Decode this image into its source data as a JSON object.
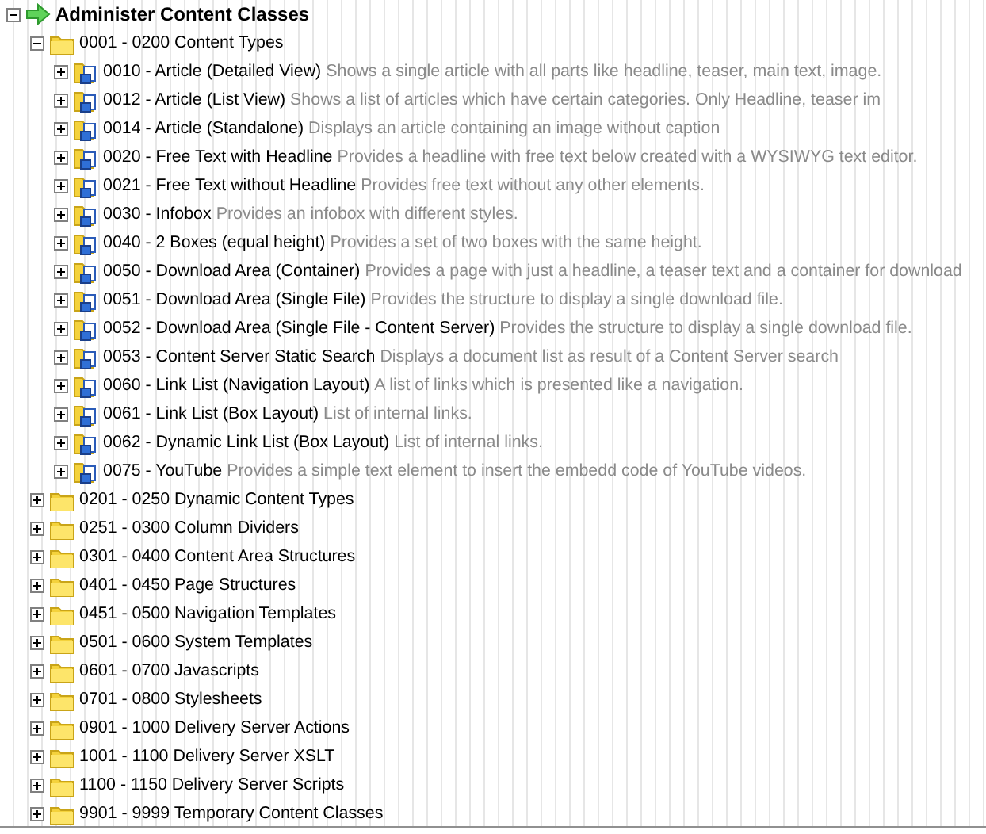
{
  "tree": {
    "kind": "root",
    "label": "Administer Content Classes",
    "expanded": true,
    "children": [
      {
        "kind": "folder",
        "label": "0001 - 0200 Content Types",
        "expanded": true,
        "children": [
          {
            "kind": "class",
            "label": "0010 - Article (Detailed View)",
            "description": "Shows a single article with all parts like headline, teaser, main text, image.",
            "expanded": false
          },
          {
            "kind": "class",
            "label": "0012 - Article (List View)",
            "description": "Shows a list of articles which have certain categories. Only Headline, teaser im",
            "expanded": false
          },
          {
            "kind": "class",
            "label": "0014 - Article (Standalone)",
            "description": "Displays an article containing an image without caption",
            "expanded": false
          },
          {
            "kind": "class",
            "label": "0020 - Free Text with Headline",
            "description": "Provides a headline with free text below created with a WYSIWYG text editor.",
            "expanded": false
          },
          {
            "kind": "class",
            "label": "0021 - Free Text without Headline",
            "description": "Provides free text without any other elements.",
            "expanded": false
          },
          {
            "kind": "class",
            "label": "0030 - Infobox",
            "description": "Provides an infobox with different styles.",
            "expanded": false
          },
          {
            "kind": "class",
            "label": "0040 - 2 Boxes (equal height)",
            "description": "Provides a set of two boxes with the same height.",
            "expanded": false
          },
          {
            "kind": "class",
            "label": "0050 - Download Area (Container)",
            "description": "Provides a page with just a headline, a teaser text and a container for download",
            "expanded": false
          },
          {
            "kind": "class",
            "label": "0051 - Download Area (Single File)",
            "description": "Provides the structure to display a single download file.",
            "expanded": false
          },
          {
            "kind": "class",
            "label": "0052 - Download Area (Single File - Content Server)",
            "description": "Provides the structure to display a single download file.",
            "expanded": false
          },
          {
            "kind": "class",
            "label": "0053 - Content Server Static Search",
            "description": "Displays a document list as result of a Content Server search",
            "expanded": false
          },
          {
            "kind": "class",
            "label": "0060 - Link List (Navigation Layout)",
            "description": "A list of links which is presented like a navigation.",
            "expanded": false
          },
          {
            "kind": "class",
            "label": "0061 - Link List (Box Layout)",
            "description": "List of internal links.",
            "expanded": false
          },
          {
            "kind": "class",
            "label": "0062 - Dynamic Link List (Box Layout)",
            "description": "List of internal links.",
            "expanded": false
          },
          {
            "kind": "class",
            "label": "0075 - YouTube",
            "description": "Provides a simple text element to insert the embedd code of YouTube videos.",
            "expanded": false
          }
        ]
      },
      {
        "kind": "folder",
        "label": "0201 - 0250 Dynamic Content Types",
        "expanded": false
      },
      {
        "kind": "folder",
        "label": "0251 - 0300 Column Dividers",
        "expanded": false
      },
      {
        "kind": "folder",
        "label": "0301 - 0400 Content Area Structures",
        "expanded": false
      },
      {
        "kind": "folder",
        "label": "0401 - 0450 Page Structures",
        "expanded": false
      },
      {
        "kind": "folder",
        "label": "0451 - 0500 Navigation Templates",
        "expanded": false
      },
      {
        "kind": "folder",
        "label": "0501 - 0600 System Templates",
        "expanded": false
      },
      {
        "kind": "folder",
        "label": "0601 - 0700 Javascripts",
        "expanded": false
      },
      {
        "kind": "folder",
        "label": "0701 - 0800 Stylesheets",
        "expanded": false
      },
      {
        "kind": "folder",
        "label": "0901 - 1000 Delivery Server Actions",
        "expanded": false
      },
      {
        "kind": "folder",
        "label": "1001 - 1100 Delivery Server XSLT",
        "expanded": false
      },
      {
        "kind": "folder",
        "label": "1100 - 1150 Delivery Server Scripts",
        "expanded": false
      },
      {
        "kind": "folder",
        "label": "9901 - 9999 Temporary Content Classes",
        "expanded": false
      }
    ]
  }
}
